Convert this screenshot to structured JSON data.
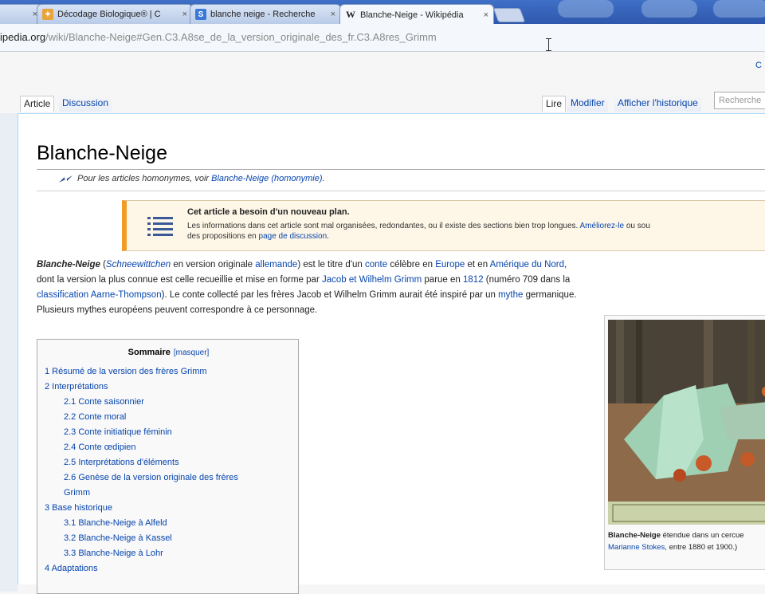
{
  "browser": {
    "tabs": [
      {
        "label": "Décodage Biologique® | C",
        "favicon": "gift-icon"
      },
      {
        "label": "blanche neige - Recherche",
        "favicon": "search-icon"
      },
      {
        "label": "Blanche-Neige - Wikipédia",
        "favicon": "wikipedia-icon",
        "active": true
      }
    ],
    "close_glyph": "×",
    "url_host": "ipedia.org",
    "url_path": "/wiki/Blanche-Neige#Gen.C3.A8se_de_la_version_originale_des_fr.C3.A8res_Grimm"
  },
  "page": {
    "top_link": "C",
    "tabs_left": [
      "Article",
      "Discussion"
    ],
    "tabs_right": [
      "Lire",
      "Modifier",
      "Afficher l'historique"
    ],
    "search_placeholder": "Recherche",
    "title": "Blanche-Neige",
    "hatnote_prefix": "Pour les articles homonymes, voir ",
    "hatnote_link": "Blanche-Neige (homonymie)",
    "hatnote_suffix": ".",
    "banner": {
      "title": "Cet article a besoin d'un nouveau plan.",
      "text_a": "Les informations dans cet article sont mal organisées, redondantes, ou il existe des sections bien trop longues. ",
      "link_a": "Améliorez-le",
      "text_b": " ou sou",
      "text_c": "des propositions en ",
      "link_b": "page de discussion",
      "text_d": "."
    },
    "intro": {
      "bold": "Blanche-Neige",
      "p1": " (",
      "l1": "Schneewittchen",
      "p2": " en version originale ",
      "l2": "allemande",
      "p3": ") est le titre d'un ",
      "l3": "conte",
      "p4": " célèbre en ",
      "l4": "Europe",
      "p5": " et en ",
      "l5": "Amérique du Nord",
      "p6": ", dont la version la plus connue est celle recueillie et mise en forme par ",
      "l6": "Jacob et Wilhelm Grimm",
      "p7": " parue en ",
      "l7": "1812",
      "p8": " (numéro 709 dans la ",
      "l8": "classification Aarne-Thompson",
      "p9": "). Le conte collecté par les frères Jacob et Wilhelm Grimm aurait été inspiré par un ",
      "l9": "mythe",
      "p10": " germanique. Plusieurs mythes européens peuvent correspondre à ce personnage."
    },
    "toc": {
      "title": "Sommaire",
      "hide": "[masquer]",
      "items": [
        "1 Résumé de la version des frères Grimm",
        "2 Interprétations",
        "2.1 Conte saisonnier",
        "2.2 Conte moral",
        "2.3 Conte initiatique féminin",
        "2.4 Conte œdipien",
        "2.5 Interprétations d'éléments",
        "2.6 Genèse de la version originale des frères",
        "Grimm",
        "3 Base historique",
        "3.1 Blanche-Neige à Alfeld",
        "3.2 Blanche-Neige à Kassel",
        "3.3 Blanche-Neige à Lohr",
        "4 Adaptations"
      ]
    },
    "thumb": {
      "caption_bold": "Blanche-Neige",
      "caption_a": " étendue dans un cercue",
      "caption_link": "Marianne Stokes",
      "caption_b": ", entre 1880 et 1900.)"
    }
  }
}
